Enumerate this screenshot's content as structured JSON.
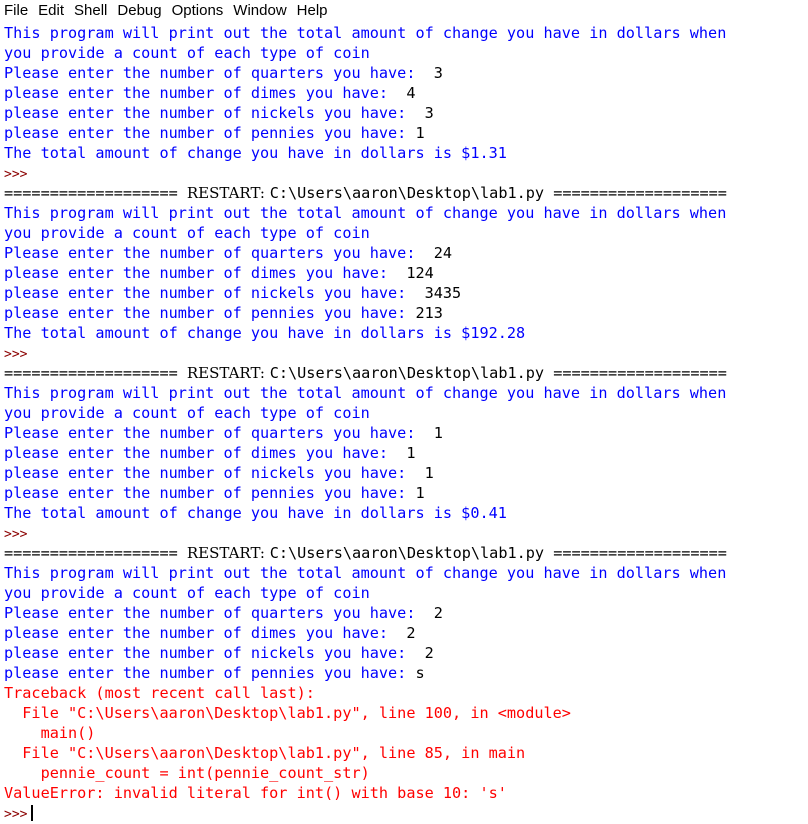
{
  "menu": [
    "File",
    "Edit",
    "Shell",
    "Debug",
    "Options",
    "Window",
    "Help"
  ],
  "lines": [
    {
      "kind": "out",
      "text": "This program will print out the total amount of change you have in dollars when"
    },
    {
      "kind": "out",
      "text": "you provide a count of each type of coin"
    },
    {
      "kind": "q",
      "prompt": "Please enter the number of quarters you have: ",
      "input": " 3"
    },
    {
      "kind": "q",
      "prompt": "please enter the number of dimes you have: ",
      "input": " 4"
    },
    {
      "kind": "q",
      "prompt": "please enter the number of nickels you have: ",
      "input": " 3"
    },
    {
      "kind": "q",
      "prompt": "please enter the number of pennies you have: ",
      "input": "1"
    },
    {
      "kind": "out",
      "text": "The total amount of change you have in dollars is $1.31"
    },
    {
      "kind": "prompt",
      "text": ">>>"
    },
    {
      "kind": "restart",
      "left": "=================== ",
      "tag": "RESTART: ",
      "path": "C:\\Users\\aaron\\Desktop\\lab1.py",
      "right": " ==================="
    },
    {
      "kind": "out",
      "text": "This program will print out the total amount of change you have in dollars when"
    },
    {
      "kind": "out",
      "text": "you provide a count of each type of coin"
    },
    {
      "kind": "q",
      "prompt": "Please enter the number of quarters you have: ",
      "input": " 24"
    },
    {
      "kind": "q",
      "prompt": "please enter the number of dimes you have: ",
      "input": " 124"
    },
    {
      "kind": "q",
      "prompt": "please enter the number of nickels you have: ",
      "input": " 3435"
    },
    {
      "kind": "q",
      "prompt": "please enter the number of pennies you have: ",
      "input": "213"
    },
    {
      "kind": "out",
      "text": "The total amount of change you have in dollars is $192.28"
    },
    {
      "kind": "prompt",
      "text": ">>>"
    },
    {
      "kind": "restart",
      "left": "=================== ",
      "tag": "RESTART: ",
      "path": "C:\\Users\\aaron\\Desktop\\lab1.py",
      "right": " ==================="
    },
    {
      "kind": "out",
      "text": "This program will print out the total amount of change you have in dollars when"
    },
    {
      "kind": "out",
      "text": "you provide a count of each type of coin"
    },
    {
      "kind": "q",
      "prompt": "Please enter the number of quarters you have: ",
      "input": " 1"
    },
    {
      "kind": "q",
      "prompt": "please enter the number of dimes you have: ",
      "input": " 1"
    },
    {
      "kind": "q",
      "prompt": "please enter the number of nickels you have: ",
      "input": " 1"
    },
    {
      "kind": "q",
      "prompt": "please enter the number of pennies you have: ",
      "input": "1"
    },
    {
      "kind": "out",
      "text": "The total amount of change you have in dollars is $0.41"
    },
    {
      "kind": "prompt",
      "text": ">>>"
    },
    {
      "kind": "restart",
      "left": "=================== ",
      "tag": "RESTART: ",
      "path": "C:\\Users\\aaron\\Desktop\\lab1.py",
      "right": " ==================="
    },
    {
      "kind": "out",
      "text": "This program will print out the total amount of change you have in dollars when"
    },
    {
      "kind": "out",
      "text": "you provide a count of each type of coin"
    },
    {
      "kind": "q",
      "prompt": "Please enter the number of quarters you have: ",
      "input": " 2"
    },
    {
      "kind": "q",
      "prompt": "please enter the number of dimes you have: ",
      "input": " 2"
    },
    {
      "kind": "q",
      "prompt": "please enter the number of nickels you have: ",
      "input": " 2"
    },
    {
      "kind": "q",
      "prompt": "please enter the number of pennies you have: ",
      "input": "s"
    },
    {
      "kind": "err",
      "text": "Traceback (most recent call last):"
    },
    {
      "kind": "err",
      "text": "  File \"C:\\Users\\aaron\\Desktop\\lab1.py\", line 100, in <module>"
    },
    {
      "kind": "err",
      "text": "    main()"
    },
    {
      "kind": "err",
      "text": "  File \"C:\\Users\\aaron\\Desktop\\lab1.py\", line 85, in main"
    },
    {
      "kind": "err",
      "text": "    pennie_count = int(pennie_count_str)"
    },
    {
      "kind": "err",
      "text": "ValueError: invalid literal for int() with base 10: 's'"
    },
    {
      "kind": "prompt-cursor",
      "text": ">>>"
    }
  ],
  "colors": {
    "output": "#0000ff",
    "input": "#000000",
    "error": "#ff0000",
    "prompt": "#8b0000"
  }
}
